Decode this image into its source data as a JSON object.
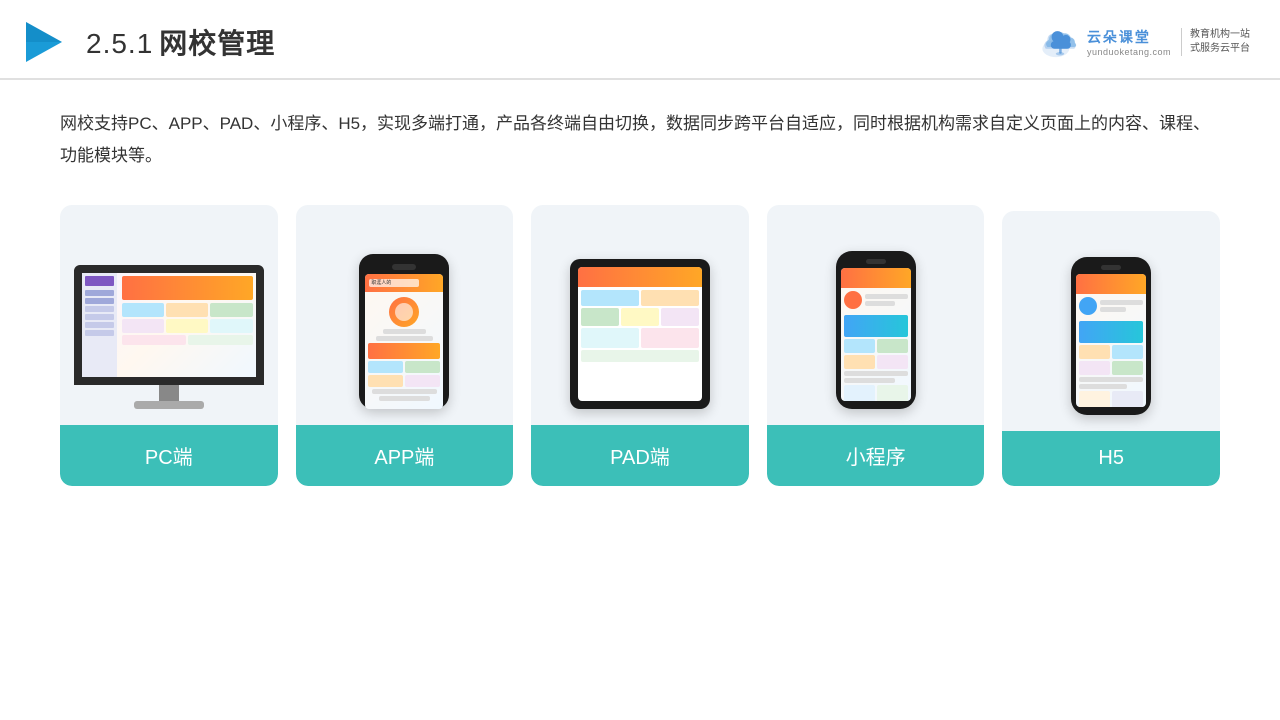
{
  "header": {
    "section_number": "2.5.1",
    "title": "网校管理",
    "brand": {
      "name": "云朵课堂",
      "url": "yunduoketang.com",
      "slogan": "教育机构一站\n式服务云平台"
    }
  },
  "description": "网校支持PC、APP、PAD、小程序、H5，实现多端打通，产品各终端自由切换，数据同步跨平台自适应，同时根据机构需求自定义页面上的内容、课程、功能模块等。",
  "devices": [
    {
      "id": "pc",
      "label": "PC端",
      "type": "monitor"
    },
    {
      "id": "app",
      "label": "APP端",
      "type": "phone"
    },
    {
      "id": "pad",
      "label": "PAD端",
      "type": "tablet"
    },
    {
      "id": "miniprogram",
      "label": "小程序",
      "type": "phone-tall"
    },
    {
      "id": "h5",
      "label": "H5",
      "type": "phone-tall"
    }
  ],
  "colors": {
    "teal": "#3cbfb8",
    "accent_orange": "#ff7043",
    "accent_yellow": "#ffa726",
    "accent_blue": "#42a5f5"
  }
}
